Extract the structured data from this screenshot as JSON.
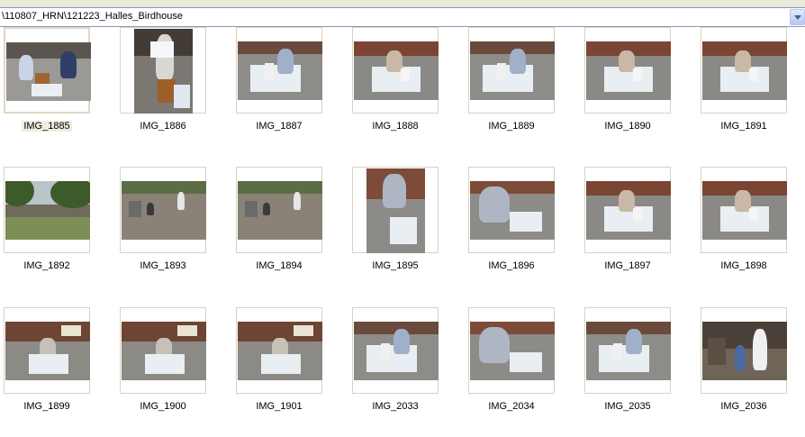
{
  "address_bar": {
    "path": "\\110807_HRN\\121223_Halles_Birdhouse"
  },
  "colors": {
    "address_border": "#7f9db9",
    "selection": "#efebde",
    "thumb_border": "#d6d3c4"
  },
  "thumbnails": [
    {
      "label": "IMG_1885",
      "orientation": "landscape",
      "selected": true,
      "scene": "kids-ground"
    },
    {
      "label": "IMG_1886",
      "orientation": "portrait",
      "selected": false,
      "scene": "kid-standing"
    },
    {
      "label": "IMG_1887",
      "orientation": "landscape",
      "selected": false,
      "scene": "painting"
    },
    {
      "label": "IMG_1888",
      "orientation": "landscape",
      "selected": false,
      "scene": "painting-brick"
    },
    {
      "label": "IMG_1889",
      "orientation": "landscape",
      "selected": false,
      "scene": "painting"
    },
    {
      "label": "IMG_1890",
      "orientation": "landscape",
      "selected": false,
      "scene": "painting-brick"
    },
    {
      "label": "IMG_1891",
      "orientation": "landscape",
      "selected": false,
      "scene": "painting-brick"
    },
    {
      "label": "IMG_1892",
      "orientation": "landscape",
      "selected": false,
      "scene": "park"
    },
    {
      "label": "IMG_1893",
      "orientation": "landscape",
      "selected": false,
      "scene": "driveway"
    },
    {
      "label": "IMG_1894",
      "orientation": "landscape",
      "selected": false,
      "scene": "driveway"
    },
    {
      "label": "IMG_1895",
      "orientation": "portrait",
      "selected": false,
      "scene": "kid-closeup"
    },
    {
      "label": "IMG_1896",
      "orientation": "landscape",
      "selected": false,
      "scene": "kid-closeup"
    },
    {
      "label": "IMG_1897",
      "orientation": "landscape",
      "selected": false,
      "scene": "painting-brick"
    },
    {
      "label": "IMG_1898",
      "orientation": "landscape",
      "selected": false,
      "scene": "painting-brick"
    },
    {
      "label": "IMG_1899",
      "orientation": "landscape",
      "selected": false,
      "scene": "house-front"
    },
    {
      "label": "IMG_1900",
      "orientation": "landscape",
      "selected": false,
      "scene": "house-front"
    },
    {
      "label": "IMG_1901",
      "orientation": "landscape",
      "selected": false,
      "scene": "house-front"
    },
    {
      "label": "IMG_2033",
      "orientation": "landscape",
      "selected": false,
      "scene": "painting"
    },
    {
      "label": "IMG_2034",
      "orientation": "landscape",
      "selected": false,
      "scene": "kid-closeup"
    },
    {
      "label": "IMG_2035",
      "orientation": "landscape",
      "selected": false,
      "scene": "painting"
    },
    {
      "label": "IMG_2036",
      "orientation": "landscape",
      "selected": false,
      "scene": "garage"
    }
  ]
}
